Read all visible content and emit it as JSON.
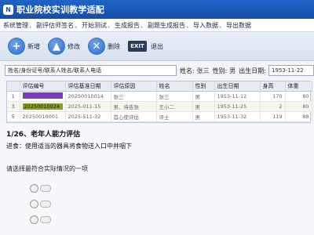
{
  "app": {
    "logo_text": "N",
    "title": "职业院校实训教学适配"
  },
  "menu": [
    {
      "label": "系统管理"
    },
    {
      "label": "副评估师签名"
    },
    {
      "label": "开始测试"
    },
    {
      "label": "生成报告"
    },
    {
      "label": "副题生成报告"
    },
    {
      "label": "导入数据"
    },
    {
      "label": "导出数据"
    }
  ],
  "menu_separator": "、",
  "toolbar": {
    "buttons": [
      {
        "label": "新增",
        "icon": "plus-icon",
        "glyph": "+",
        "color": "#2c6fd1"
      },
      {
        "label": "修改",
        "icon": "up-arrow-icon",
        "glyph": "▲",
        "color": "#2c6fd1"
      },
      {
        "label": "删除",
        "icon": "close-icon",
        "glyph": "✕",
        "color": "#2c6fd1"
      },
      {
        "label": "退出",
        "icon": "exit-icon",
        "glyph": "EXIT",
        "color": "#2a3c5c"
      }
    ]
  },
  "filter": {
    "search_value": "姓名/身份证号/联系人姓名/联系人电话",
    "name_label": "姓名:",
    "name_value": "张三",
    "gender_label": "性别:",
    "gender_value": "男",
    "birth_label": "出生日期:",
    "birth_value": "1953-11-22"
  },
  "table": {
    "columns": [
      "",
      "评估编号",
      "评估基准日期",
      "评估原因",
      "姓名",
      "性别",
      "出生日期",
      "身高",
      "体重"
    ],
    "rows": [
      {
        "num": "1",
        "code": "",
        "code_color": "#7b3fb5",
        "date": "20250010014",
        "reason": "张三",
        "name": "张三",
        "gender": "男",
        "birth": "1953-11-12",
        "height": "170",
        "weight": "80"
      },
      {
        "num": "3",
        "code": "20250010024",
        "code_color": "#8aa02a",
        "date": "2025-011-15",
        "reason": "男、待告张",
        "name": "王小二",
        "gender": "男",
        "birth": "1953-11-25",
        "height": "2",
        "weight": "80"
      },
      {
        "num": "5",
        "code": "20250010001",
        "code_color": "",
        "date": "2025-511-32",
        "reason": "首心使评估",
        "name": "评士",
        "gender": "男",
        "birth": "1953-11-32",
        "height": "119",
        "weight": "88"
      }
    ]
  },
  "question": {
    "title": "1/26、老年人能力评估",
    "subtitle": "进食：使用适当的器具将食物送入口中并咽下",
    "prompt": "请选择最符合实际情况的一项",
    "option_count": 3
  },
  "colors": {
    "title_bar": "#1a56b8",
    "accent": "#2c6fd1"
  }
}
